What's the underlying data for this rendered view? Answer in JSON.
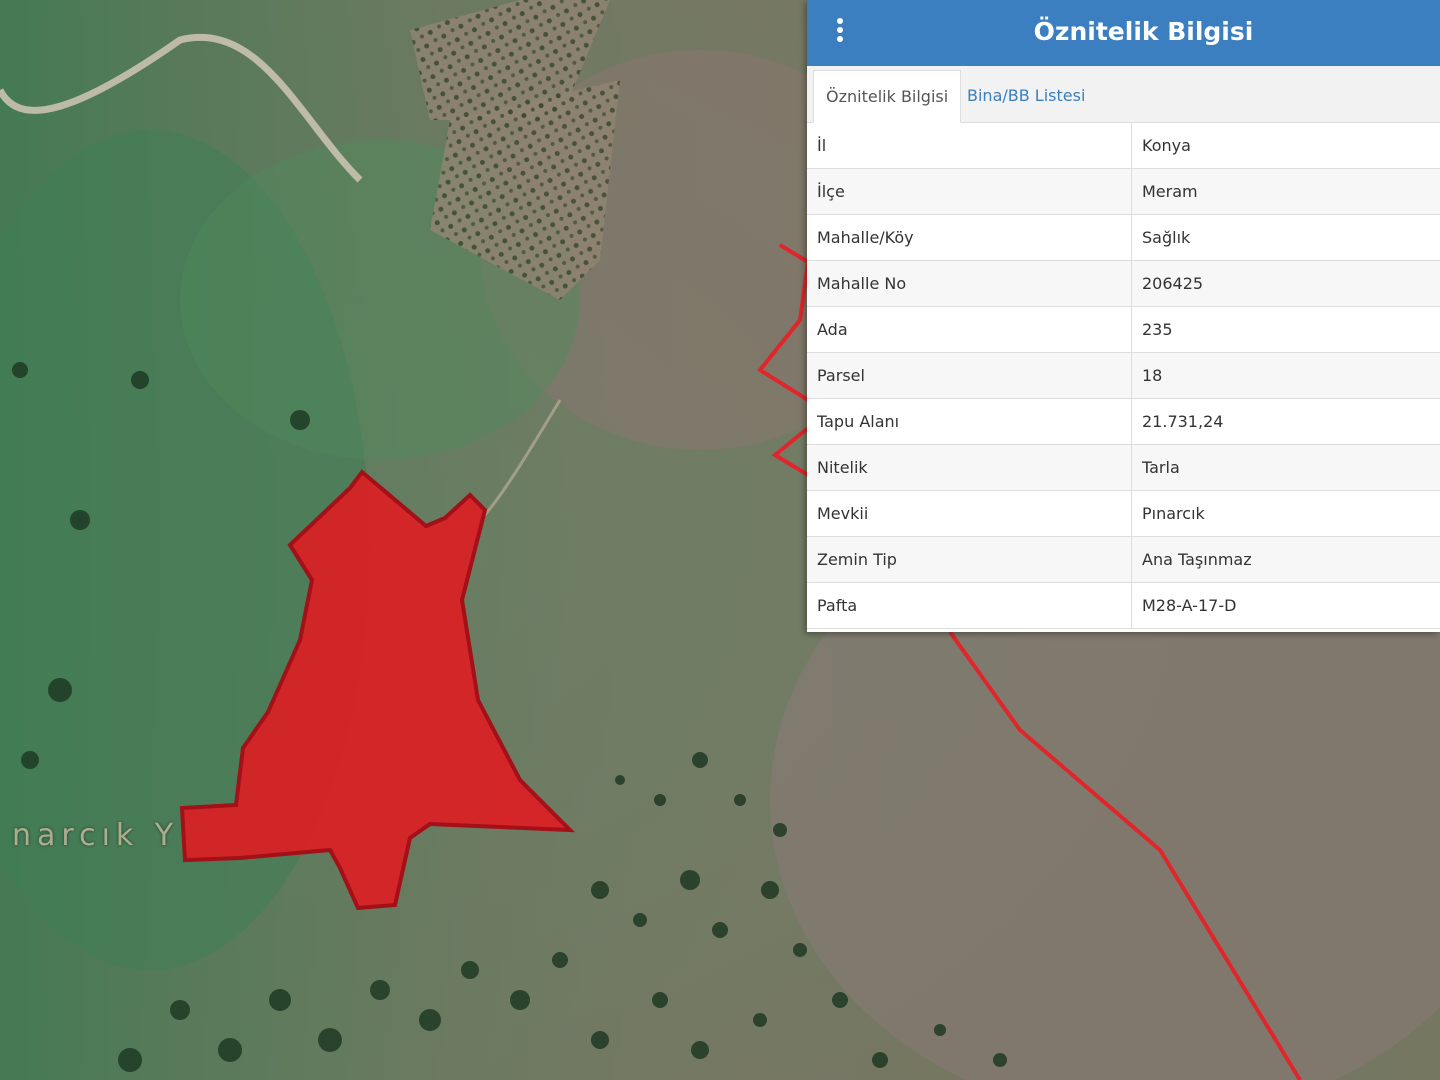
{
  "map": {
    "place_label": "narcık Y",
    "parcel_color": "#dc1f25",
    "parcel_outline": "#a31018",
    "boundary_color": "#e0262a"
  },
  "panel": {
    "title": "Öznitelik Bilgisi",
    "menu_icon": "vertical-dots-icon",
    "header_color": "#3b7fc0",
    "tabs": [
      {
        "label": "Öznitelik Bilgisi",
        "active": true
      },
      {
        "label": "Bina/BB Listesi",
        "active": false
      }
    ],
    "rows": [
      {
        "key": "İl",
        "value": "Konya"
      },
      {
        "key": "İlçe",
        "value": "Meram"
      },
      {
        "key": "Mahalle/Köy",
        "value": "Sağlık"
      },
      {
        "key": "Mahalle No",
        "value": "206425"
      },
      {
        "key": "Ada",
        "value": "235"
      },
      {
        "key": "Parsel",
        "value": "18"
      },
      {
        "key": "Tapu Alanı",
        "value": "21.731,24"
      },
      {
        "key": "Nitelik",
        "value": "Tarla"
      },
      {
        "key": "Mevkii",
        "value": "Pınarcık"
      },
      {
        "key": "Zemin Tip",
        "value": "Ana Taşınmaz"
      },
      {
        "key": "Pafta",
        "value": "M28-A-17-D"
      }
    ]
  }
}
